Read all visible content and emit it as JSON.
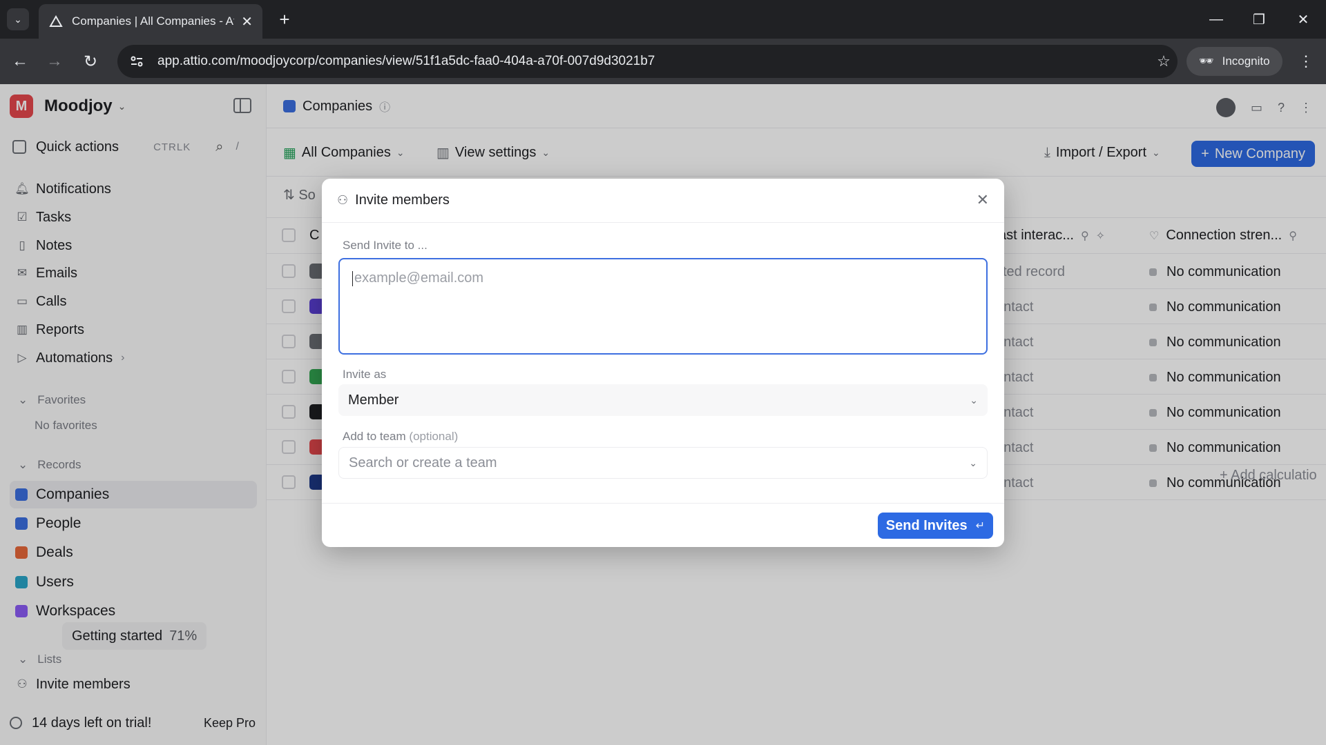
{
  "browser": {
    "tab_title": "Companies | All Companies - At",
    "url": "app.attio.com/moodjoycorp/companies/view/51f1a5dc-faa0-404a-a70f-007d9d3021b7",
    "incognito_label": "Incognito"
  },
  "workspace": {
    "initial": "M",
    "name": "Moodjoy"
  },
  "quick_actions": {
    "label": "Quick actions",
    "shortcut": "CTRLK",
    "slash": "/"
  },
  "nav": [
    {
      "label": "Notifications"
    },
    {
      "label": "Tasks"
    },
    {
      "label": "Notes"
    },
    {
      "label": "Emails"
    },
    {
      "label": "Calls"
    },
    {
      "label": "Reports"
    },
    {
      "label": "Automations"
    }
  ],
  "favorites": {
    "header": "Favorites",
    "empty": "No favorites"
  },
  "records": {
    "header": "Records",
    "items": [
      {
        "label": "Companies",
        "color": "#3b6fe0"
      },
      {
        "label": "People",
        "color": "#3b6fe0"
      },
      {
        "label": "Deals",
        "color": "#e8683a"
      },
      {
        "label": "Users",
        "color": "#2aa5c9"
      },
      {
        "label": "Workspaces",
        "color": "#8b5cf6"
      }
    ]
  },
  "getting_started": {
    "label": "Getting started",
    "percent": "71%"
  },
  "lists": {
    "header": "Lists",
    "invite_label": "Invite members"
  },
  "trial": {
    "text": "14 days left on trial!",
    "action": "Keep Pro"
  },
  "main": {
    "title": "Companies",
    "view_name": "All Companies",
    "view_settings": "View settings",
    "import_export": "Import / Export",
    "new_company": "New Company",
    "sort_label": "So",
    "col_first": "C",
    "col_interaction": "ast interac...",
    "col_connection": "Connection stren...",
    "add_calc": "Add calculatio"
  },
  "rows": [
    {
      "interaction": "cted record",
      "connection": "No communication",
      "logo_color": "#6b6e75"
    },
    {
      "interaction": "ontact",
      "connection": "No communication",
      "logo_color": "#5b3fd6"
    },
    {
      "interaction": "ontact",
      "connection": "No communication",
      "logo_color": "#6b6e75"
    },
    {
      "interaction": "ontact",
      "connection": "No communication",
      "logo_color": "#34a853"
    },
    {
      "interaction": "ontact",
      "connection": "No communication",
      "logo_color": "#1f2023"
    },
    {
      "interaction": "ontact",
      "connection": "No communication",
      "logo_color": "#e5484d"
    },
    {
      "interaction": "ontact",
      "connection": "No communication",
      "logo_color": "#1e3a8a"
    }
  ],
  "modal": {
    "title": "Invite members",
    "send_to_label": "Send Invite to ...",
    "email_placeholder": "example@email.com",
    "invite_as_label": "Invite as",
    "role_value": "Member",
    "team_label": "Add to team",
    "team_optional": "(optional)",
    "team_placeholder": "Search or create a team",
    "send_button": "Send Invites",
    "send_shortcut": "↵"
  }
}
